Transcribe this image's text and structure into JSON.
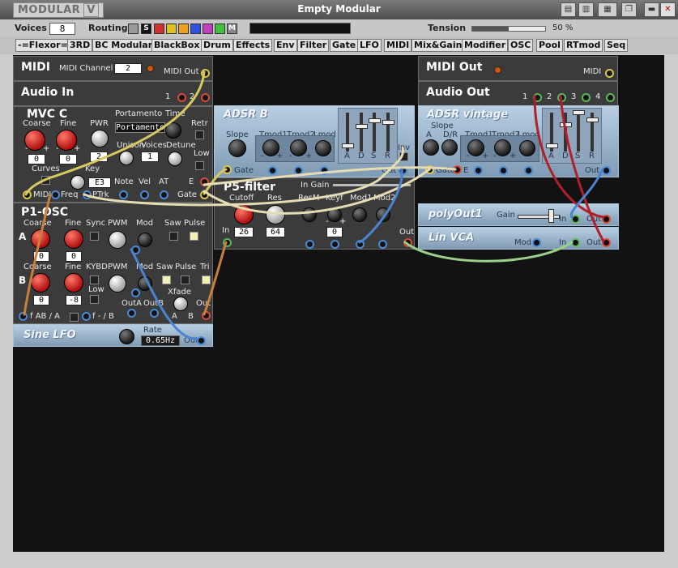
{
  "window": {
    "logo": "MODULAR",
    "logo_mark": "V",
    "title": "Empty Modular"
  },
  "toolbar": {
    "voices_label": "Voices",
    "voices_value": "8",
    "routing_label": "Routing",
    "routing_s": "S",
    "routing_m": "M",
    "routing_colors": [
      "#d03030",
      "#e0c020",
      "#f0a020",
      "#3050e0",
      "#c040c0",
      "#40c040"
    ],
    "tension_label": "Tension",
    "tension_value": "50 %",
    "tension_level": 0.5
  },
  "categories": [
    "-=Flexor=-",
    "3RD",
    "BC Modular",
    "BlackBox",
    "Drum",
    "Effects",
    "Env",
    "Filter",
    "Gate",
    "LFO",
    "MIDI",
    "Mix&Gain",
    "Modifier",
    "OSC",
    "Pool",
    "RTmod",
    "Seq"
  ],
  "modules": {
    "midi": {
      "title": "MIDI",
      "channel_label": "MIDI Channel",
      "channel_value": "2",
      "out_label": "MIDI Out"
    },
    "audio_in": {
      "title": "Audio In",
      "port1": "1",
      "port2": "2"
    },
    "mvc": {
      "title": "MVC C",
      "coarse": "Coarse",
      "fine": "Fine",
      "pwr": "PWR",
      "portamento": "Portamento",
      "portamento_value": "Portamento",
      "time": "Time",
      "retr": "Retr",
      "unison": "Unison",
      "voices": "Voices",
      "detune": "Detune",
      "low": "Low",
      "curves": "Curves",
      "key": "Key",
      "coarse_val": "0",
      "fine_val": "0",
      "pwr_val": "2",
      "voices_val": "1",
      "key_val": "E3",
      "minus": "-",
      "plus": "+",
      "midi": "MIDI",
      "freq": "Freq",
      "ptrk": "PTrk",
      "note": "Note",
      "vel": "Vel",
      "at": "AT",
      "gate": "Gate",
      "e": "E"
    },
    "p1osc": {
      "title": "P1-OSC",
      "a": "A",
      "b": "B",
      "coarse": "Coarse",
      "fine": "Fine",
      "sync": "Sync",
      "pwm": "PWM",
      "mod": "Mod",
      "saw": "Saw",
      "pulse": "Pulse",
      "a_coarse": "0",
      "a_fine": "0",
      "b_coarse": "0",
      "b_fine": "-8",
      "kybd": "KYBD",
      "low": "Low",
      "tri": "Tri",
      "xfade": "Xfade",
      "outa": "OutA",
      "outb": "OutB",
      "out": "Out",
      "fab": "f AB / A",
      "fb": "f - / B",
      "a2": "A",
      "b2": "B"
    },
    "sinelfo": {
      "title": "Sine LFO",
      "rate": "Rate",
      "rate_value": "0.65Hz",
      "out": "Out"
    },
    "adsrb": {
      "title": "ADSR B",
      "slope": "Slope",
      "tmod1": "Tmod1",
      "tmod2": "Tmod2",
      "lmod": "Lmod",
      "a": "A",
      "d": "D",
      "s": "S",
      "r": "R",
      "inv": "Inv",
      "gate": "Gate",
      "out": "Out",
      "minus": "-",
      "plus": "+"
    },
    "p5filter": {
      "title": "P5-filter",
      "in_gain": "In Gain",
      "cutoff": "Cutoff",
      "res": "Res",
      "resm": "ResM",
      "keyf": "Keyf",
      "mod1": "Mod1",
      "mod2": "Mod2",
      "in": "In",
      "out": "Out",
      "cutoff_val": "26",
      "res_val": "64",
      "keyf_val": "0",
      "minus": "-",
      "plus": "+"
    },
    "midiout": {
      "title": "MIDI Out",
      "midi": "MIDI"
    },
    "audioout": {
      "title": "Audio Out",
      "p1": "1",
      "p2": "2",
      "p3": "3",
      "p4": "4"
    },
    "adsrv": {
      "title": "ADSR vintage",
      "slope": "Slope",
      "a": "A",
      "dr": "D/R",
      "tmod1": "Tmod1",
      "tmod2": "Tmod2",
      "lmod": "Lmod",
      "gate": "Gate",
      "e": "E",
      "out": "Out",
      "fa": "A",
      "fd": "D",
      "fs": "S",
      "fr": "R",
      "minus": "-",
      "plus": "+"
    },
    "polyout": {
      "title": "polyOut1",
      "gain": "Gain",
      "in": "In",
      "out": "Out"
    },
    "linvca": {
      "title": "Lin VCA",
      "mod": "Mod",
      "in": "In",
      "out": "Out"
    }
  }
}
